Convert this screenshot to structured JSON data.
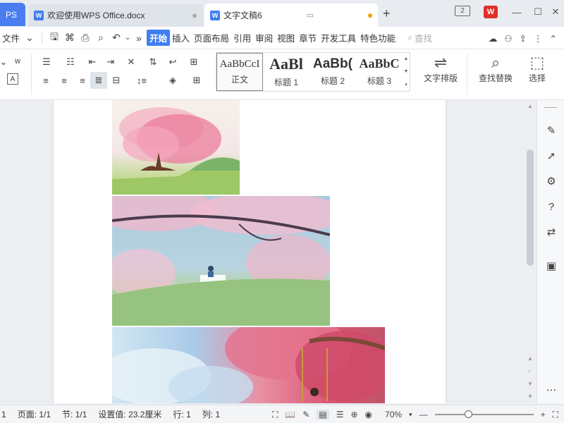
{
  "tabs": {
    "app_label": "PS",
    "doc1_title": "欢迎使用WPS Office.docx",
    "doc2_title": "文字文稿6",
    "doc_icon_letter": "W",
    "close_glyph": "●",
    "new_tab": "+"
  },
  "window": {
    "badge": "2",
    "logo": "W",
    "minimize": "—",
    "maximize": "☐",
    "close": "✕"
  },
  "menu": {
    "file": "文件",
    "items": [
      "开始",
      "插入",
      "页面布局",
      "引用",
      "审阅",
      "视图",
      "章节",
      "开发工具",
      "特色功能"
    ],
    "more": "»",
    "search_placeholder": "查找"
  },
  "ribbon": {
    "styles": [
      {
        "sample": "AaBbCcI",
        "name": "正文"
      },
      {
        "sample": "AaBl",
        "name": "标题 1"
      },
      {
        "sample": "AaBb(",
        "name": "标题 2"
      },
      {
        "sample": "AaBbC",
        "name": "标题 3"
      }
    ],
    "text_layout": "文字排版",
    "find_replace": "查找替换",
    "select": "选择"
  },
  "statusbar": {
    "page_num": "1",
    "page": "页面: 1/1",
    "section": "节: 1/1",
    "setting": "设置值: 23.2厘米",
    "row": "行: 1",
    "col": "列: 1",
    "zoom": "70%",
    "zoom_fraction": 0.33
  },
  "colors": {
    "accent": "#3f7ef0",
    "wps_red": "#e0302a",
    "modified_dot": "#f2a20c"
  }
}
